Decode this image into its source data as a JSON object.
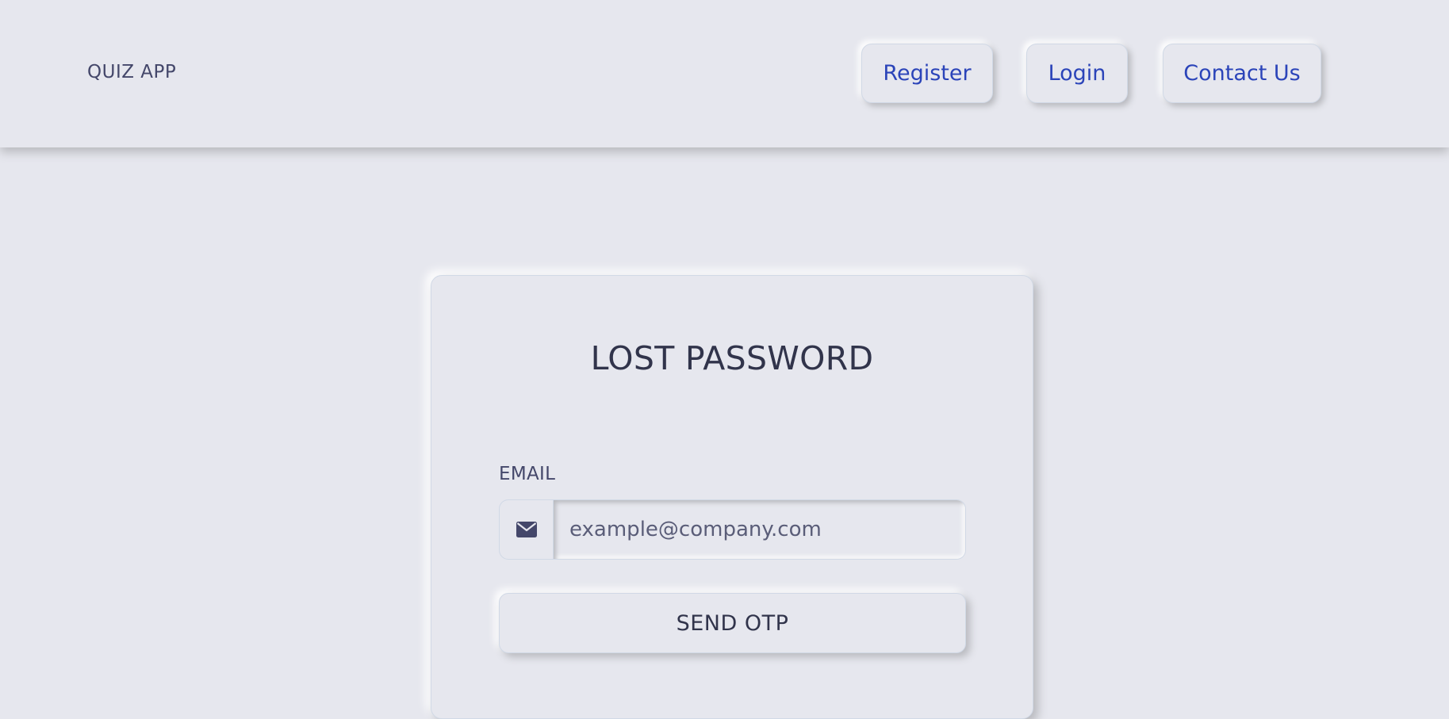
{
  "header": {
    "brand": "QUIZ APP",
    "nav": {
      "register": "Register",
      "login": "Login",
      "contact": "Contact Us"
    }
  },
  "form": {
    "title": "LOST PASSWORD",
    "email_label": "EMAIL",
    "email_icon": "envelope-icon",
    "email_placeholder": "example@company.com",
    "email_value": "",
    "submit_label": "SEND OTP"
  },
  "colors": {
    "background": "#e6e7ee",
    "link": "#2b44b9",
    "text_dark": "#31344b",
    "text_muted": "#44476a"
  }
}
